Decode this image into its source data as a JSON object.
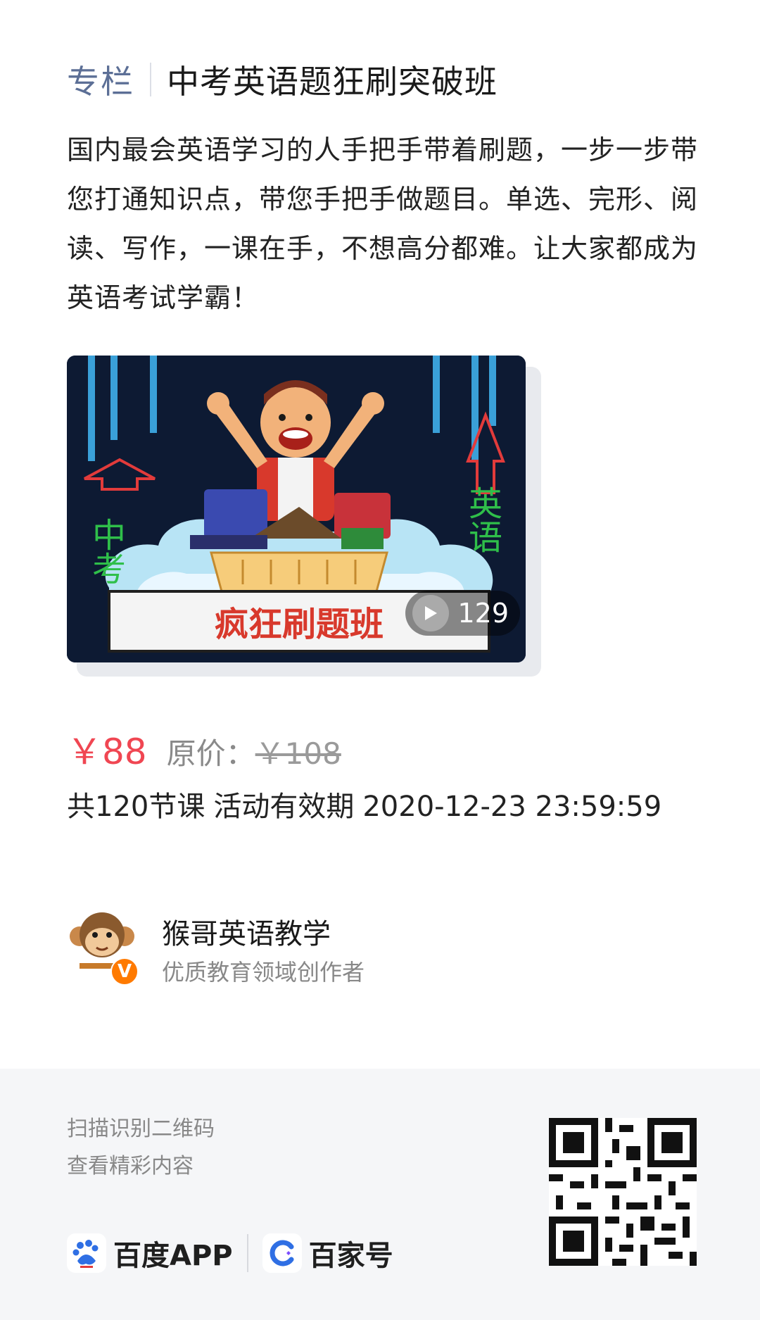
{
  "header": {
    "tag": "专栏",
    "title": "中考英语题狂刷突破班"
  },
  "description": "国内最会英语学习的人手把手带着刷题，一步一步带您打通知识点，带您手把手做题目。单选、完形、阅读、写作，一课在手，不想高分都难。让大家都成为英语考试学霸！",
  "cover": {
    "banner_text": "疯狂刷题班",
    "left_text": "中考",
    "right_text": "英语",
    "video_count": "129"
  },
  "pricing": {
    "current_price": "￥88",
    "original_label": "原价：",
    "original_price": "￥108"
  },
  "course_meta": {
    "lessons": "共120节课",
    "validity_label": "活动有效期",
    "validity_date": "2020-12-23 23:59:59"
  },
  "author": {
    "name": "猴哥英语教学",
    "desc": "优质教育领域创作者",
    "badge": "V"
  },
  "footer": {
    "scan_line1": "扫描识别二维码",
    "scan_line2": "查看精彩内容",
    "brand1": "百度APP",
    "brand2": "百家号"
  },
  "colors": {
    "price": "#f04652",
    "tag": "#5c6f96",
    "footer_bg": "#f5f6f8"
  }
}
